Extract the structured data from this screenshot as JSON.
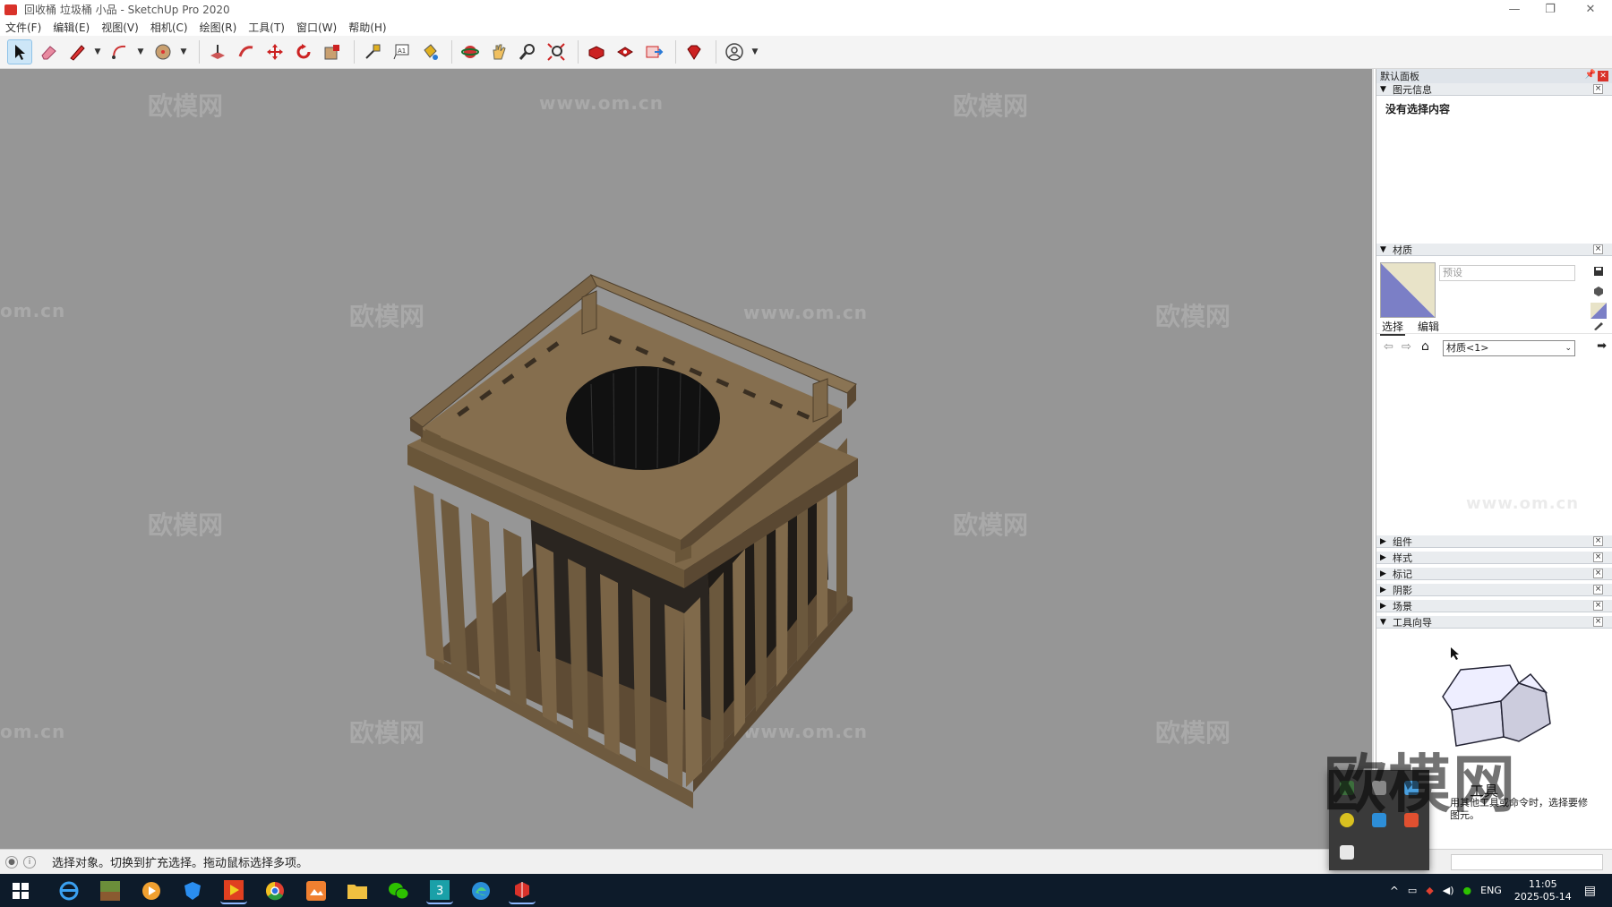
{
  "window": {
    "title": "回收桶 垃圾桶 小品 - SketchUp Pro 2020",
    "minimize": "—",
    "restore": "❐",
    "close": "✕"
  },
  "menu": [
    "文件(F)",
    "编辑(E)",
    "视图(V)",
    "相机(C)",
    "绘图(R)",
    "工具(T)",
    "窗口(W)",
    "帮助(H)"
  ],
  "toolbar": {
    "tools": [
      "select-tool",
      "eraser-tool",
      "line-tool",
      "arc-tool",
      "shape-tool",
      "push-pull-tool",
      "follow-me-tool",
      "move-tool",
      "rotate-tool",
      "scale-tool",
      "tape-measure-tool",
      "text-tool",
      "paint-bucket-tool",
      "orbit-tool",
      "pan-tool",
      "zoom-tool",
      "zoom-extents-tool",
      "warehouse-tool",
      "extension-tool",
      "send-layout-tool",
      "ruby-tool",
      "account-tool"
    ]
  },
  "watermarks": {
    "brand": "欧模网",
    "url": "www.om.cn",
    "short": "om.cn"
  },
  "tray": {
    "title": "默认面板",
    "entity": {
      "header": "图元信息",
      "body": "没有选择内容"
    },
    "materials": {
      "header": "材质",
      "name_placeholder": "预设",
      "tab_select": "选择",
      "tab_edit": "编辑",
      "collection": "材质<1>"
    },
    "sections": [
      "组件",
      "样式",
      "标记",
      "阴影",
      "场景"
    ],
    "guide": {
      "header": "工具向导",
      "tool_name": "工具",
      "desc_line1": "用其他工具或命令时，选择要修",
      "desc_line2": "图元。"
    }
  },
  "status": {
    "text": "选择对象。切换到扩充选择。拖动鼠标选择多项。"
  },
  "taskbar": {
    "lang": "ENG",
    "time": "11:05",
    "date": "2025-05-14"
  },
  "colors": {
    "viewport_bg": "#969696",
    "wood": "#7a6446",
    "accent": "#d9322a"
  }
}
